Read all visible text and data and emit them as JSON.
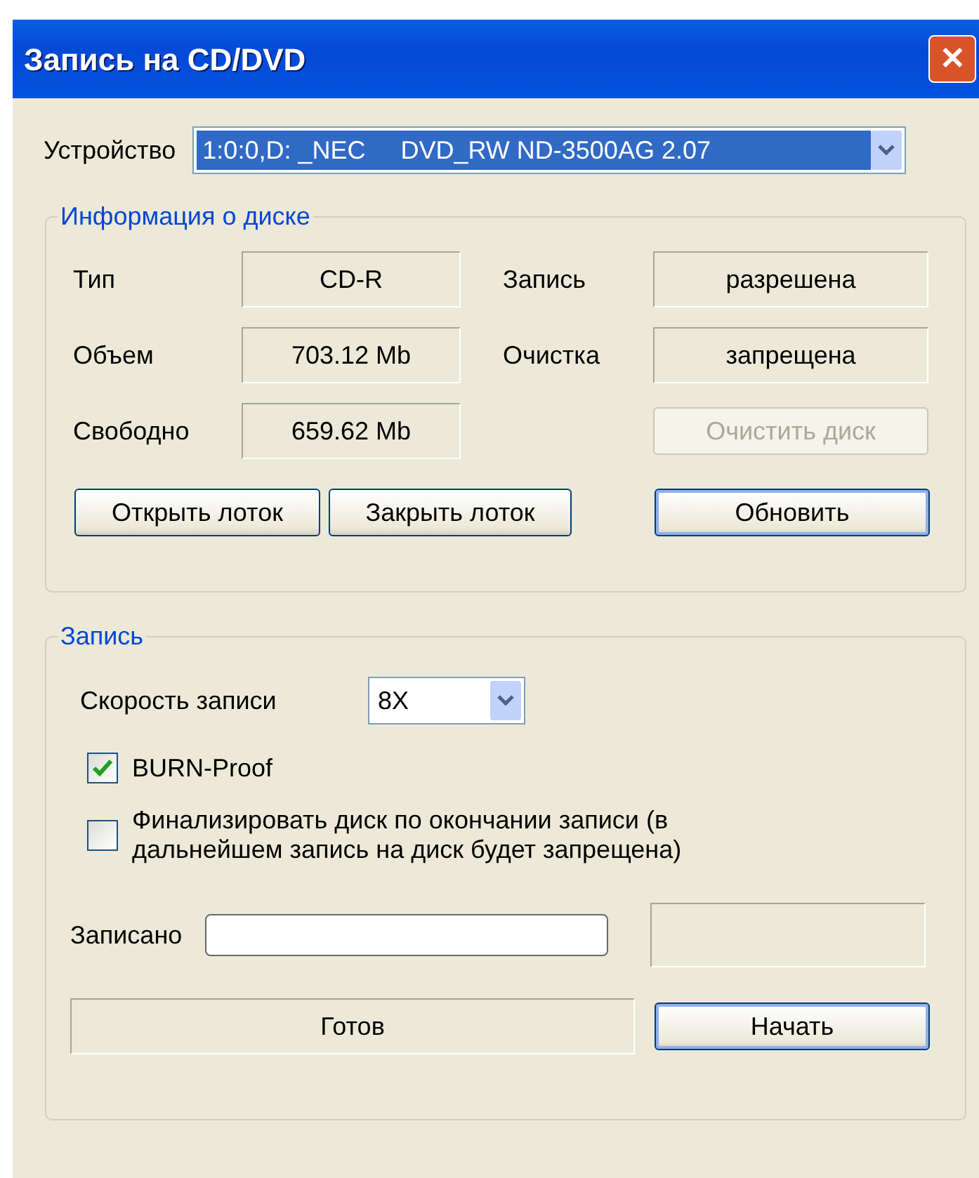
{
  "window": {
    "title": "Запись на CD/DVD",
    "close": "✕"
  },
  "device": {
    "label": "Устройство",
    "value": "1:0:0,D: _NEC     DVD_RW ND-3500AG 2.07",
    "highlighted": true
  },
  "disk_info": {
    "title": "Информация о диске",
    "left": [
      {
        "label": "Тип",
        "value": "CD-R"
      },
      {
        "label": "Объем",
        "value": "703.12 Mb"
      },
      {
        "label": "Свободно",
        "value": "659.62 Mb"
      }
    ],
    "right": [
      {
        "label": "Запись",
        "value": "разрешена"
      },
      {
        "label": "Очистка",
        "value": "запрещена"
      }
    ],
    "buttons": [
      {
        "label": "Очистить диск",
        "disabled": true,
        "default": false
      },
      {
        "label": "Открыть лоток",
        "disabled": false,
        "default": false
      },
      {
        "label": "Закрыть лоток",
        "disabled": false,
        "default": false
      },
      {
        "label": "Обновить",
        "disabled": false,
        "default": true
      }
    ]
  },
  "burn": {
    "title": "Запись",
    "speed": {
      "label": "Скорость записи",
      "value": "8X"
    },
    "options": [
      {
        "label": "BURN-Proof",
        "checked": true
      },
      {
        "label": "Финализировать диск по окончании записи (в дальнейшем запись на диск будет запрещена)",
        "checked": false
      }
    ],
    "progress": {
      "label": "Записано",
      "level": 0
    },
    "status": "Готов",
    "start": {
      "label": "Начать",
      "default": true
    }
  }
}
